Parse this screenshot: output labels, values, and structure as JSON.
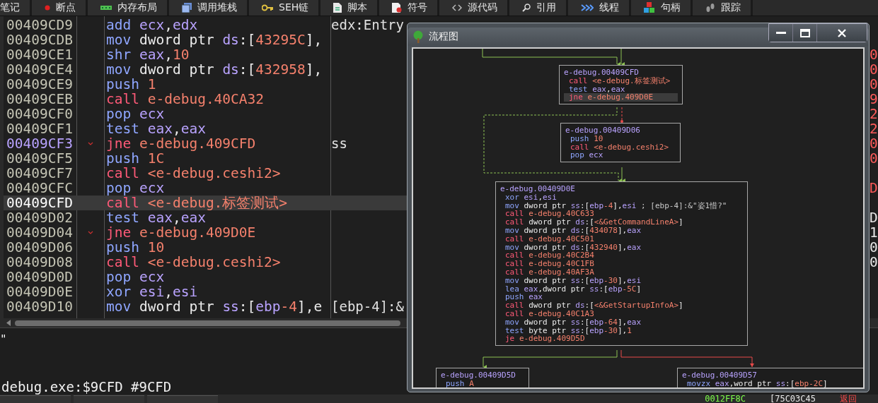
{
  "toolbar_tabs": [
    {
      "label": "笔记"
    },
    {
      "label": "断点"
    },
    {
      "label": "内存布局"
    },
    {
      "label": "调用堆栈"
    },
    {
      "label": "SEH链"
    },
    {
      "label": "脚本"
    },
    {
      "label": "符号"
    },
    {
      "label": "源代码"
    },
    {
      "label": "引用"
    },
    {
      "label": "线程"
    },
    {
      "label": "句柄"
    },
    {
      "label": "跟踪"
    }
  ],
  "disassembly": {
    "rows": [
      {
        "address": "00409CD9",
        "selected": false,
        "jump_target": false,
        "branch_mark": false,
        "comment": "edx:Entry",
        "instruction": [
          {
            "text": "add ",
            "kind": "op"
          },
          {
            "text": "ecx",
            "kind": "reg"
          },
          {
            "text": ",",
            "kind": "plain"
          },
          {
            "text": "edx",
            "kind": "reg"
          }
        ]
      },
      {
        "address": "00409CDB",
        "selected": false,
        "jump_target": false,
        "branch_mark": false,
        "instruction": [
          {
            "text": "mov ",
            "kind": "op"
          },
          {
            "text": "dword ptr ",
            "kind": "plain"
          },
          {
            "text": "ds",
            "kind": "reg"
          },
          {
            "text": ":[",
            "kind": "plain"
          },
          {
            "text": "43295C",
            "kind": "num"
          },
          {
            "text": "],",
            "kind": "plain"
          }
        ]
      },
      {
        "address": "00409CE1",
        "selected": false,
        "jump_target": false,
        "branch_mark": false,
        "edge": {
          "text": "0",
          "kind": "red"
        },
        "instruction": [
          {
            "text": "shr ",
            "kind": "op"
          },
          {
            "text": "eax",
            "kind": "reg"
          },
          {
            "text": ",",
            "kind": "plain"
          },
          {
            "text": "10",
            "kind": "num"
          }
        ]
      },
      {
        "address": "00409CE4",
        "selected": false,
        "jump_target": false,
        "branch_mark": false,
        "edge": {
          "text": "0",
          "kind": "red"
        },
        "instruction": [
          {
            "text": "mov ",
            "kind": "op"
          },
          {
            "text": "dword ptr ",
            "kind": "plain"
          },
          {
            "text": "ds",
            "kind": "reg"
          },
          {
            "text": ":[",
            "kind": "plain"
          },
          {
            "text": "432958",
            "kind": "num"
          },
          {
            "text": "],",
            "kind": "plain"
          }
        ]
      },
      {
        "address": "00409CE9",
        "selected": false,
        "jump_target": false,
        "branch_mark": false,
        "edge": {
          "text": "0",
          "kind": "red"
        },
        "instruction": [
          {
            "text": "push ",
            "kind": "op"
          },
          {
            "text": "1",
            "kind": "num"
          }
        ]
      },
      {
        "address": "00409CEB",
        "selected": false,
        "jump_target": false,
        "branch_mark": false,
        "edge": {
          "text": "9",
          "kind": "red"
        },
        "instruction": [
          {
            "text": "call ",
            "kind": "call"
          },
          {
            "text": "e-debug.40CA32",
            "kind": "num"
          }
        ]
      },
      {
        "address": "00409CF0",
        "selected": false,
        "jump_target": false,
        "branch_mark": false,
        "edge": {
          "text": "2",
          "kind": "red"
        },
        "instruction": [
          {
            "text": "pop ",
            "kind": "op"
          },
          {
            "text": "ecx",
            "kind": "reg"
          }
        ]
      },
      {
        "address": "00409CF1",
        "selected": false,
        "jump_target": false,
        "branch_mark": false,
        "edge": {
          "text": "2",
          "kind": "red"
        },
        "instruction": [
          {
            "text": "test ",
            "kind": "op"
          },
          {
            "text": "eax",
            "kind": "reg"
          },
          {
            "text": ",",
            "kind": "plain"
          },
          {
            "text": "eax",
            "kind": "reg"
          }
        ]
      },
      {
        "address": "00409CF3",
        "selected": false,
        "jump_target": true,
        "branch_mark": true,
        "comment": "ss",
        "edge": {
          "text": "0",
          "kind": "red"
        },
        "instruction": [
          {
            "text": "jne ",
            "kind": "call"
          },
          {
            "text": "e-debug.409CFD",
            "kind": "num"
          }
        ]
      },
      {
        "address": "00409CF5",
        "selected": false,
        "jump_target": false,
        "branch_mark": false,
        "edge": {
          "text": "0",
          "kind": "red"
        },
        "instruction": [
          {
            "text": "push ",
            "kind": "op"
          },
          {
            "text": "1C",
            "kind": "num"
          }
        ]
      },
      {
        "address": "00409CF7",
        "selected": false,
        "jump_target": false,
        "branch_mark": false,
        "instruction": [
          {
            "text": "call ",
            "kind": "call"
          },
          {
            "text": "<e-debug.ceshi2>",
            "kind": "num"
          }
        ]
      },
      {
        "address": "00409CFC",
        "selected": false,
        "jump_target": false,
        "branch_mark": false,
        "edge": {
          "text": "D",
          "kind": "red"
        },
        "instruction": [
          {
            "text": "pop ",
            "kind": "op"
          },
          {
            "text": "ecx",
            "kind": "reg"
          }
        ]
      },
      {
        "address": "00409CFD",
        "selected": true,
        "jump_target": false,
        "branch_mark": false,
        "instruction": [
          {
            "text": "call ",
            "kind": "call"
          },
          {
            "text": "<e-debug.标签测试>",
            "kind": "num"
          }
        ]
      },
      {
        "address": "00409D02",
        "selected": false,
        "jump_target": false,
        "branch_mark": false,
        "edge": {
          "text": "D",
          "kind": "white"
        },
        "instruction": [
          {
            "text": "test ",
            "kind": "op"
          },
          {
            "text": "eax",
            "kind": "reg"
          },
          {
            "text": ",",
            "kind": "plain"
          },
          {
            "text": "eax",
            "kind": "reg"
          }
        ]
      },
      {
        "address": "00409D04",
        "selected": false,
        "jump_target": false,
        "branch_mark": true,
        "edge": {
          "text": "1",
          "kind": "white"
        },
        "instruction": [
          {
            "text": "jne ",
            "kind": "call"
          },
          {
            "text": "e-debug.409D0E",
            "kind": "num"
          }
        ]
      },
      {
        "address": "00409D06",
        "selected": false,
        "jump_target": false,
        "branch_mark": false,
        "edge": {
          "text": "0",
          "kind": "white"
        },
        "instruction": [
          {
            "text": "push ",
            "kind": "op"
          },
          {
            "text": "10",
            "kind": "num"
          }
        ]
      },
      {
        "address": "00409D08",
        "selected": false,
        "jump_target": false,
        "branch_mark": false,
        "edge": {
          "text": "0",
          "kind": "white"
        },
        "instruction": [
          {
            "text": "call ",
            "kind": "call"
          },
          {
            "text": "<e-debug.ceshi2>",
            "kind": "num"
          }
        ]
      },
      {
        "address": "00409D0D",
        "selected": false,
        "jump_target": false,
        "branch_mark": false,
        "instruction": [
          {
            "text": "pop ",
            "kind": "op"
          },
          {
            "text": "ecx",
            "kind": "reg"
          }
        ]
      },
      {
        "address": "00409D0E",
        "selected": false,
        "jump_target": false,
        "branch_mark": false,
        "instruction": [
          {
            "text": "xor ",
            "kind": "op"
          },
          {
            "text": "esi",
            "kind": "reg"
          },
          {
            "text": ",",
            "kind": "plain"
          },
          {
            "text": "esi",
            "kind": "reg"
          }
        ]
      },
      {
        "address": "00409D10",
        "selected": false,
        "jump_target": false,
        "branch_mark": false,
        "comment": "[ebp-4]:&",
        "instruction": [
          {
            "text": "mov ",
            "kind": "op"
          },
          {
            "text": "dword ptr ",
            "kind": "plain"
          },
          {
            "text": "ss",
            "kind": "reg"
          },
          {
            "text": ":[",
            "kind": "plain"
          },
          {
            "text": "ebp",
            "kind": "reg"
          },
          {
            "text": "-4",
            "kind": "num"
          },
          {
            "text": "],e",
            "kind": "plain"
          }
        ]
      }
    ]
  },
  "log": {
    "lines": [
      "\""
    ],
    "command_status": "debug.exe:$9CFD #9CFD"
  },
  "status_bar": {
    "items": [
      {
        "text": "0012FF8C",
        "kind": "green"
      },
      {
        "text": "[75C03C45",
        "kind": "white"
      },
      {
        "text": "返回",
        "kind": "red"
      }
    ]
  },
  "flow_window": {
    "title": "流程图",
    "blocks": [
      {
        "header": "e-debug.00409CFD",
        "lines": [
          {
            "selected": false,
            "parts": [
              {
                "text": "call ",
                "kind": "call"
              },
              {
                "text": "<e-debug.标签测试>",
                "kind": "num"
              }
            ]
          },
          {
            "selected": false,
            "parts": [
              {
                "text": "test ",
                "kind": "op"
              },
              {
                "text": "eax",
                "kind": "reg"
              },
              {
                "text": ",",
                "kind": "plain"
              },
              {
                "text": "eax",
                "kind": "reg"
              }
            ]
          },
          {
            "selected": true,
            "parts": [
              {
                "text": "jne ",
                "kind": "call"
              },
              {
                "text": "e-debug.409D0E",
                "kind": "num"
              }
            ]
          }
        ]
      },
      {
        "header": "e-debug.00409D06",
        "lines": [
          {
            "selected": false,
            "parts": [
              {
                "text": "push ",
                "kind": "op"
              },
              {
                "text": "10",
                "kind": "num"
              }
            ]
          },
          {
            "selected": false,
            "parts": [
              {
                "text": "call ",
                "kind": "call"
              },
              {
                "text": "<e-debug.ceshi2>",
                "kind": "num"
              }
            ]
          },
          {
            "selected": false,
            "parts": [
              {
                "text": "pop ",
                "kind": "op"
              },
              {
                "text": "ecx",
                "kind": "reg"
              }
            ]
          }
        ]
      },
      {
        "header": "e-debug.00409D0E",
        "lines": [
          {
            "selected": false,
            "parts": [
              {
                "text": "xor ",
                "kind": "op"
              },
              {
                "text": "esi",
                "kind": "reg"
              },
              {
                "text": ",",
                "kind": "plain"
              },
              {
                "text": "esi",
                "kind": "reg"
              }
            ]
          },
          {
            "selected": false,
            "parts": [
              {
                "text": "mov ",
                "kind": "op"
              },
              {
                "text": "dword ptr ",
                "kind": "plain"
              },
              {
                "text": "ss",
                "kind": "reg"
              },
              {
                "text": ":[",
                "kind": "plain"
              },
              {
                "text": "ebp",
                "kind": "reg"
              },
              {
                "text": "-4",
                "kind": "num"
              },
              {
                "text": "],",
                "kind": "plain"
              },
              {
                "text": "esi",
                "kind": "reg"
              },
              {
                "text": " ; [ebp-4]:&\"姿1惜?\"",
                "kind": "comment"
              }
            ]
          },
          {
            "selected": false,
            "parts": [
              {
                "text": "call ",
                "kind": "call"
              },
              {
                "text": "e-debug.40C633",
                "kind": "num"
              }
            ]
          },
          {
            "selected": false,
            "parts": [
              {
                "text": "call ",
                "kind": "call"
              },
              {
                "text": "dword ptr ",
                "kind": "plain"
              },
              {
                "text": "ds",
                "kind": "reg"
              },
              {
                "text": ":[",
                "kind": "plain"
              },
              {
                "text": "<&GetCommandLineA>",
                "kind": "num"
              },
              {
                "text": "]",
                "kind": "plain"
              }
            ]
          },
          {
            "selected": false,
            "parts": [
              {
                "text": "mov ",
                "kind": "op"
              },
              {
                "text": "dword ptr ",
                "kind": "plain"
              },
              {
                "text": "ds",
                "kind": "reg"
              },
              {
                "text": ":[",
                "kind": "plain"
              },
              {
                "text": "434078",
                "kind": "num"
              },
              {
                "text": "],",
                "kind": "plain"
              },
              {
                "text": "eax",
                "kind": "reg"
              }
            ]
          },
          {
            "selected": false,
            "parts": [
              {
                "text": "call ",
                "kind": "call"
              },
              {
                "text": "e-debug.40C501",
                "kind": "num"
              }
            ]
          },
          {
            "selected": false,
            "parts": [
              {
                "text": "mov ",
                "kind": "op"
              },
              {
                "text": "dword ptr ",
                "kind": "plain"
              },
              {
                "text": "ds",
                "kind": "reg"
              },
              {
                "text": ":[",
                "kind": "plain"
              },
              {
                "text": "432940",
                "kind": "num"
              },
              {
                "text": "],",
                "kind": "plain"
              },
              {
                "text": "eax",
                "kind": "reg"
              }
            ]
          },
          {
            "selected": false,
            "parts": [
              {
                "text": "call ",
                "kind": "call"
              },
              {
                "text": "e-debug.40C2B4",
                "kind": "num"
              }
            ]
          },
          {
            "selected": false,
            "parts": [
              {
                "text": "call ",
                "kind": "call"
              },
              {
                "text": "e-debug.40C1FB",
                "kind": "num"
              }
            ]
          },
          {
            "selected": false,
            "parts": [
              {
                "text": "call ",
                "kind": "call"
              },
              {
                "text": "e-debug.40AF3A",
                "kind": "num"
              }
            ]
          },
          {
            "selected": false,
            "parts": [
              {
                "text": "mov ",
                "kind": "op"
              },
              {
                "text": "dword ptr ",
                "kind": "plain"
              },
              {
                "text": "ss",
                "kind": "reg"
              },
              {
                "text": ":[",
                "kind": "plain"
              },
              {
                "text": "ebp",
                "kind": "reg"
              },
              {
                "text": "-30",
                "kind": "num"
              },
              {
                "text": "],",
                "kind": "plain"
              },
              {
                "text": "esi",
                "kind": "reg"
              }
            ]
          },
          {
            "selected": false,
            "parts": [
              {
                "text": "lea ",
                "kind": "op"
              },
              {
                "text": "eax",
                "kind": "reg"
              },
              {
                "text": ",dword ptr ",
                "kind": "plain"
              },
              {
                "text": "ss",
                "kind": "reg"
              },
              {
                "text": ":[",
                "kind": "plain"
              },
              {
                "text": "ebp",
                "kind": "reg"
              },
              {
                "text": "-5C",
                "kind": "num"
              },
              {
                "text": "]",
                "kind": "plain"
              }
            ]
          },
          {
            "selected": false,
            "parts": [
              {
                "text": "push ",
                "kind": "op"
              },
              {
                "text": "eax",
                "kind": "reg"
              }
            ]
          },
          {
            "selected": false,
            "parts": [
              {
                "text": "call ",
                "kind": "call"
              },
              {
                "text": "dword ptr ",
                "kind": "plain"
              },
              {
                "text": "ds",
                "kind": "reg"
              },
              {
                "text": ":[",
                "kind": "plain"
              },
              {
                "text": "<&GetStartupInfoA>",
                "kind": "num"
              },
              {
                "text": "]",
                "kind": "plain"
              }
            ]
          },
          {
            "selected": false,
            "parts": [
              {
                "text": "call ",
                "kind": "call"
              },
              {
                "text": "e-debug.40C1A3",
                "kind": "num"
              }
            ]
          },
          {
            "selected": false,
            "parts": [
              {
                "text": "mov ",
                "kind": "op"
              },
              {
                "text": "dword ptr ",
                "kind": "plain"
              },
              {
                "text": "ss",
                "kind": "reg"
              },
              {
                "text": ":[",
                "kind": "plain"
              },
              {
                "text": "ebp",
                "kind": "reg"
              },
              {
                "text": "-64",
                "kind": "num"
              },
              {
                "text": "],",
                "kind": "plain"
              },
              {
                "text": "eax",
                "kind": "reg"
              }
            ]
          },
          {
            "selected": false,
            "parts": [
              {
                "text": "test ",
                "kind": "op"
              },
              {
                "text": "byte ptr ",
                "kind": "plain"
              },
              {
                "text": "ss",
                "kind": "reg"
              },
              {
                "text": ":[",
                "kind": "plain"
              },
              {
                "text": "ebp",
                "kind": "reg"
              },
              {
                "text": "-30",
                "kind": "num"
              },
              {
                "text": "],",
                "kind": "plain"
              },
              {
                "text": "1",
                "kind": "num"
              }
            ]
          },
          {
            "selected": false,
            "parts": [
              {
                "text": "je ",
                "kind": "call"
              },
              {
                "text": "e-debug.409D5D",
                "kind": "num"
              }
            ]
          }
        ]
      },
      {
        "header": "e-debug.00409D5D",
        "lines": [
          {
            "selected": false,
            "parts": [
              {
                "text": "push ",
                "kind": "op"
              },
              {
                "text": "A",
                "kind": "num"
              }
            ]
          }
        ]
      },
      {
        "header": "e-debug.00409D57",
        "lines": [
          {
            "selected": false,
            "parts": [
              {
                "text": "movzx ",
                "kind": "op"
              },
              {
                "text": "eax",
                "kind": "reg"
              },
              {
                "text": ",word ptr ",
                "kind": "plain"
              },
              {
                "text": "ss",
                "kind": "reg"
              },
              {
                "text": ":[",
                "kind": "plain"
              },
              {
                "text": "ebp-2C",
                "kind": "num"
              },
              {
                "text": "]",
                "kind": "plain"
              }
            ]
          }
        ]
      }
    ]
  }
}
